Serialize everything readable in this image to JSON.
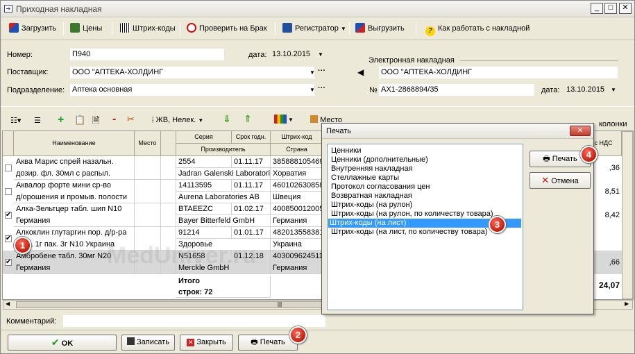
{
  "window": {
    "title": "Приходная накладная"
  },
  "toolbar": {
    "load": "Загрузить",
    "prices": "Цены",
    "barcodes": "Штрих-коды",
    "check_defect": "Проверить на Брак",
    "registrar": "Регистратор",
    "unload": "Выгрузить",
    "help": "Как работать с накладной"
  },
  "form": {
    "number_label": "Номер:",
    "number_value": "П940",
    "date_label": "дата:",
    "date_value": "13.10.2015",
    "supplier_label": "Поставщик:",
    "supplier_value": "ООО \"АПТЕКА-ХОЛДИНГ",
    "department_label": "Подразделение:",
    "department_value": "Аптека основная",
    "edoc_label": "Электронная накладная",
    "edoc_supplier": "ООО \"АПТЕКА-ХОЛДИНГ",
    "edoc_no_label": "№",
    "edoc_no_value": "АХ1-2868894/35",
    "edoc_date_label": "дата:",
    "edoc_date_value": "13.10.2015"
  },
  "toolbar2": {
    "filter": "ЖВ, Нелек.",
    "place": "Место",
    "columns": "колонки"
  },
  "grid": {
    "headers": {
      "name": "Наименование",
      "place": "Место",
      "series": "Серия",
      "manufacturer": "Производитель",
      "expiry": "Срок годн.",
      "barcode": "Штрих-код",
      "country": "Страна",
      "vat": "с НДС"
    },
    "rows": [
      {
        "name1": "Аква Марис спрей назальн.",
        "name2": "дозир. фл. 30мл с распыл.",
        "series": "2554",
        "manufacturer": "Jadran Galenski Laboratorij",
        "expiry": "01.11.17",
        "barcode": "385888105469",
        "country": "Хорватия",
        "sum": ",36",
        "checked": ""
      },
      {
        "name1": "Аквалор форте мини ср-во",
        "name2": "д/орошения и промыв. полости",
        "series": "14113595",
        "manufacturer": "Aurena Laboratories AB",
        "expiry": "01.11.17",
        "barcode": "460102630858",
        "country": "Швеция",
        "sum": "8,51",
        "checked": ""
      },
      {
        "name1": "Алка-Зельтцер табл. шип N10",
        "name2": "Германия",
        "series": "BTAEEZC",
        "manufacturer": "Bayer Bitterfeld GmbH",
        "expiry": "01.02.17",
        "barcode": "400850012005",
        "country": "Германия",
        "sum": "8,42",
        "checked": "✔"
      },
      {
        "name1": "Алкоклин глутаргин пор. д/р-ра",
        "name2": "д/пр. 1г пак. 3г N10 Украина",
        "series": "91214",
        "manufacturer": "Здоровье",
        "expiry": "01.01.17",
        "barcode": "482013558381",
        "country": "Украина",
        "sum": "",
        "checked": "✔"
      },
      {
        "name1": "Амбробене табл. 30мг N20",
        "name2": "Германия",
        "series": "N51658",
        "manufacturer": "Merckle GmbH",
        "expiry": "01.12.18",
        "barcode": "403009624511",
        "country": "Германия",
        "sum": ",66",
        "checked": "✔"
      }
    ],
    "total_label": "Итого",
    "rows_label": "строк: 72",
    "total_value": "24,07"
  },
  "comment_label": "Комментарий:",
  "bottom": {
    "ok": "OK",
    "save": "Записать",
    "close": "Закрыть",
    "print": "Печать"
  },
  "dialog": {
    "title": "Печать",
    "items": [
      "Ценники",
      "Ценники (дополнительные)",
      "Внутренняя накладная",
      "Стеллажные карты",
      "Протокол согласования цен",
      "Возвратная накладная",
      "Штрих-коды (на рулон)",
      "Штрих-коды (на рулон, по количеству товара)",
      "Штрих-коды (на лист)",
      "Штрих-коды (на лист, по количеству товара)"
    ],
    "selected_index": 8,
    "print_button": "Печать",
    "cancel_button": "Отмена"
  },
  "badges": [
    "1",
    "2",
    "3",
    "4"
  ],
  "watermark": "MedUniver.ru"
}
